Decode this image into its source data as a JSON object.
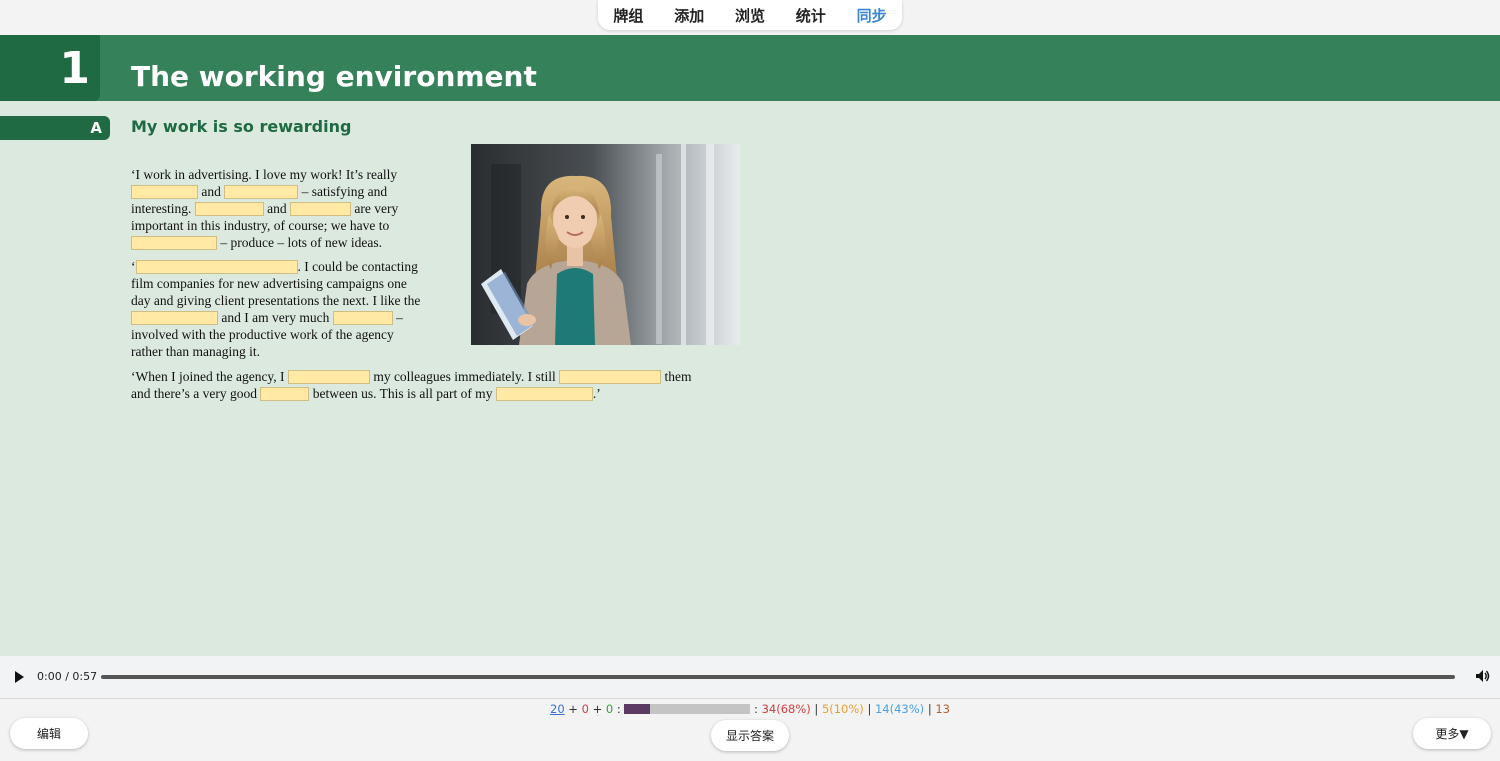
{
  "nav": {
    "items": [
      "牌组",
      "添加",
      "浏览",
      "统计",
      "同步"
    ],
    "active_index": 4
  },
  "chapter": {
    "number": "1",
    "title": "The working environment"
  },
  "section": {
    "letter": "A",
    "title": "My work is so rewarding"
  },
  "passage": {
    "p1": {
      "l1": "‘I work in advertising. I love my work! It’s really",
      "l2b": "and",
      "l2d": "– satisfying and",
      "l3a": "interesting.",
      "l3c": "and",
      "l3e": "are very",
      "l4": "important in this industry, of course; we have to",
      "l5b": "– produce – lots of new ideas."
    },
    "p2": {
      "l1a": "‘",
      "l1c": ". I could be contacting",
      "l2": "film companies for new advertising campaigns one",
      "l3": "day and giving client presentations the next. I like the",
      "l4b": "and I am very much",
      "l4d": "–",
      "l5": "involved with the productive work of the agency",
      "l6": "rather than managing it."
    },
    "p3": {
      "l1a": "‘When I joined the agency, I",
      "l1c": "my colleagues immediately. I still",
      "l1e": "them",
      "l2a": "and there’s a very good",
      "l2c": "between us. This is all part of my",
      "l2e": ".’"
    }
  },
  "audio": {
    "time": "0:00 / 0:57",
    "progress": 0
  },
  "stats": {
    "new": "20",
    "plus1": "+",
    "learning": "0",
    "plus2": "+",
    "review": "0",
    "colon1": ":",
    "colon2": ":",
    "red": "34(68%)",
    "orange": "5(10%)",
    "blue": "14(43%)",
    "brown": "13",
    "sep": "|"
  },
  "buttons": {
    "edit": "编辑",
    "show_answer": "显示答案",
    "more": "更多▼"
  },
  "colors": {
    "banner": "#35825a",
    "banner_dark": "#1f6a42",
    "background": "#dce9df",
    "blank_fill": "#ffe9a4",
    "active_nav": "#3a86d4"
  }
}
